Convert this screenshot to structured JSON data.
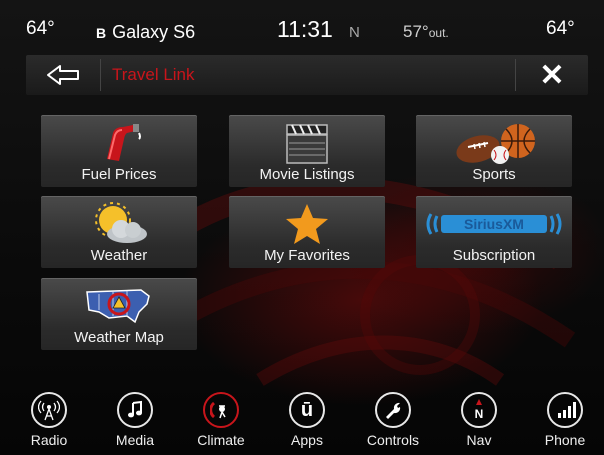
{
  "status": {
    "temp_left": "64°",
    "bluetooth_glyph": "B",
    "phone_name": "Galaxy S6",
    "time": "11:31",
    "compass": "N",
    "outside_temp": "57°",
    "outside_unit": "out.",
    "temp_right": "64°"
  },
  "titlebar": {
    "back_icon": "back-arrow-icon",
    "title": "Travel Link",
    "close_icon": "close-icon",
    "close_glyph": "✕"
  },
  "tiles": [
    {
      "label": "Fuel Prices",
      "icon": "fuel-nozzle-icon"
    },
    {
      "label": "Movie Listings",
      "icon": "clapperboard-icon"
    },
    {
      "label": "Sports",
      "icon": "sports-balls-icon"
    },
    {
      "label": "Weather",
      "icon": "sun-cloud-icon"
    },
    {
      "label": "My Favorites",
      "icon": "star-icon"
    },
    {
      "label": "Subscription",
      "icon": "siriusxm-logo-icon",
      "logo_text": "SiriusXM"
    },
    {
      "label": "Weather Map",
      "icon": "us-map-icon"
    }
  ],
  "nav": [
    {
      "label": "Radio",
      "icon": "radio-icon"
    },
    {
      "label": "Media",
      "icon": "music-note-icon"
    },
    {
      "label": "Climate",
      "icon": "climate-icon"
    },
    {
      "label": "Apps",
      "icon": "apps-icon",
      "glyph": "ū"
    },
    {
      "label": "Controls",
      "icon": "wrench-icon"
    },
    {
      "label": "Nav",
      "icon": "compass-icon",
      "glyph": "N"
    },
    {
      "label": "Phone",
      "icon": "phone-signal-icon"
    }
  ],
  "colors": {
    "accent_red": "#c8151b",
    "star": "#f29a1d",
    "sirius_blue": "#2a8fd6"
  }
}
